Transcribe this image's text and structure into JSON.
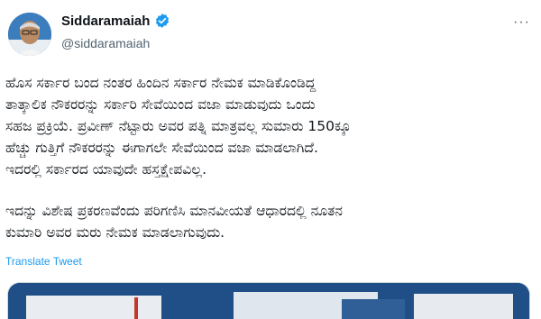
{
  "author": {
    "name": "Siddaramaiah",
    "handle": "@siddaramaiah",
    "verified_icon": "verified-badge-icon",
    "verified_color": "#1d9bf0"
  },
  "more_icon": "more-horizontal-icon",
  "more_label": "···",
  "tweet": {
    "paragraph_1": "ಹೊಸ ಸರ್ಕಾರ ಬಂದ ನಂತರ ಹಿಂದಿನ ಸರ್ಕಾರ ನೇಮಕ ಮಾಡಿಕೊಂಡಿದ್ದ\nತಾತ್ಕಾಲಿಕ ನೌಕರರನ್ನು ಸರ್ಕಾರಿ ಸೇವೆಯಿಂದ ವಜಾ ಮಾಡುವುದು ಒಂದು\nಸಹಜ ಪ್ರಕ್ರಿಯೆ. ಪ್ರವೀಣ್ ನೆಟ್ಟಾರು ಅವರ ಪತ್ನಿ ಮಾತ್ರವಲ್ಲ ಸುಮಾರು 150ಕ್ಕೂ\nಹೆಚ್ಚು ಗುತ್ತಿಗೆ ನೌಕರರನ್ನು ಈಗಾಗಲೇ ಸೇವೆಯಿಂದ ವಜಾ ಮಾಡಲಾಗಿದೆ.\nಇದರಲ್ಲಿ ಸರ್ಕಾರದ ಯಾವುದೇ ಹಸ್ತಕ್ಷೇಪವಿಲ್ಲ.",
    "paragraph_2": "ಇದನ್ನು ವಿಶೇಷ ಪ್ರಕರಣವೆಂದು ಪರಿಗಣಿಸಿ ಮಾನವೀಯತೆ ಆಧಾರದಲ್ಲಿ ನೂತನ\nಕುಮಾರಿ ಅವರ ಮರು ನೇಮಕ ಮಾಡಲಾಗುವುದು."
  },
  "translate_label": "Translate Tweet",
  "colors": {
    "text": "#0f1419",
    "secondary": "#536471",
    "link": "#1d9bf0"
  }
}
